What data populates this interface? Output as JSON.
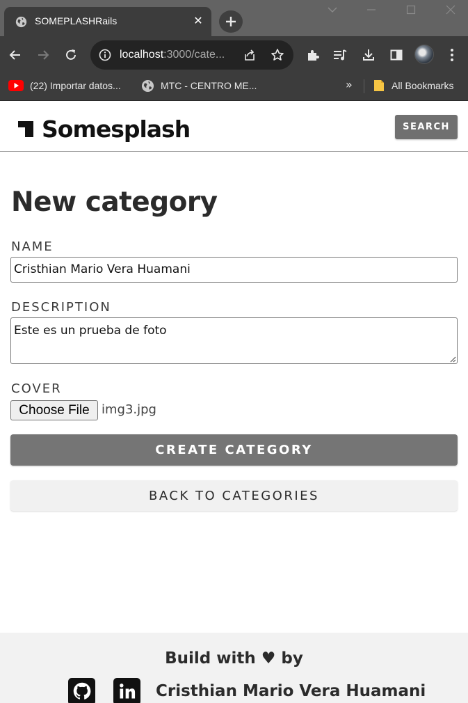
{
  "browser": {
    "tab_title": "SOMEPLASHRails",
    "url_host": "localhost",
    "url_rest": ":3000/cate...",
    "bookmarks": [
      {
        "label": "(22) Importar datos..."
      },
      {
        "label": "MTC - CENTRO ME..."
      }
    ],
    "all_bookmarks": "All Bookmarks",
    "more_bookmarks": "»"
  },
  "header": {
    "brand": "Somesplash",
    "search_label": "SEARCH"
  },
  "form": {
    "title": "New category",
    "name_label": "NAME",
    "name_value": "Cristhian Mario Vera Huamani",
    "description_label": "DESCRIPTION",
    "description_value": "Este es un prueba de foto",
    "cover_label": "COVER",
    "file_button": "Choose File",
    "file_name": "img3.jpg",
    "submit_label": "CREATE CATEGORY",
    "back_label": "BACK TO CATEGORIES"
  },
  "footer": {
    "build_text": "Build with ♥ by",
    "author": "Cristhian Mario Vera Huamani"
  },
  "colors": {
    "primary_button": "#757575",
    "secondary_button": "#f1f1f1",
    "footer_bg": "#f2f2f2",
    "browser_dark": "#3c3c3c"
  }
}
